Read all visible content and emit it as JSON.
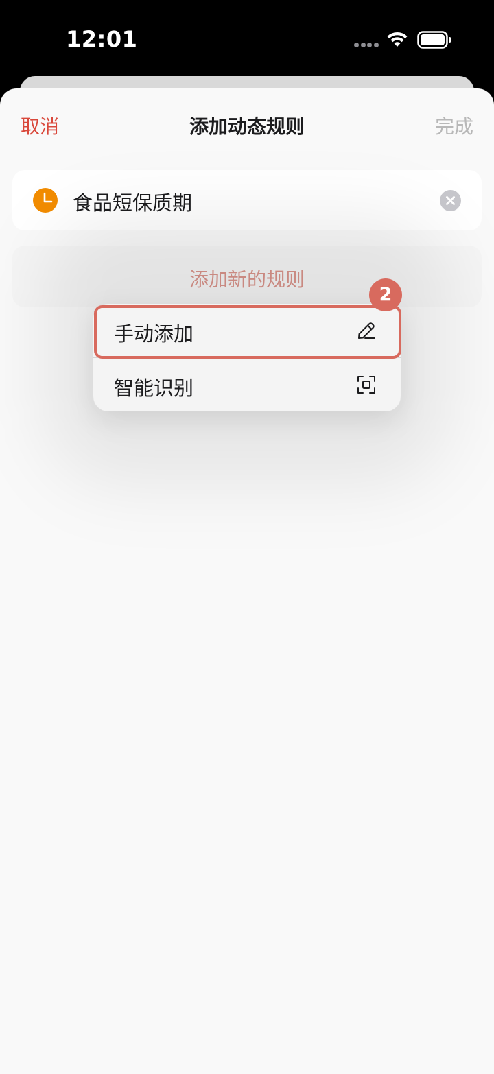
{
  "status_bar": {
    "time": "12:01",
    "icons": [
      "cellular-dots-icon",
      "wifi-icon",
      "battery-icon"
    ]
  },
  "nav": {
    "cancel_label": "取消",
    "title": "添加动态规则",
    "done_label": "完成"
  },
  "rule": {
    "icon": "clock-icon",
    "name": "食品短保质期",
    "clear_icon": "clear-icon"
  },
  "add_rule": {
    "label": "添加新的规则"
  },
  "menu": {
    "items": [
      {
        "label": "手动添加",
        "icon": "pencil-icon"
      },
      {
        "label": "智能识别",
        "icon": "scan-icon"
      }
    ]
  },
  "annotation": {
    "step_number": "2"
  },
  "colors": {
    "accent_red": "#d9483b",
    "muted_red": "#d9948b",
    "clock_orange": "#f28c00",
    "highlight": "#d86a5e",
    "disabled_gray": "#b8b8b8",
    "sheet_bg": "#f9f9f9"
  }
}
